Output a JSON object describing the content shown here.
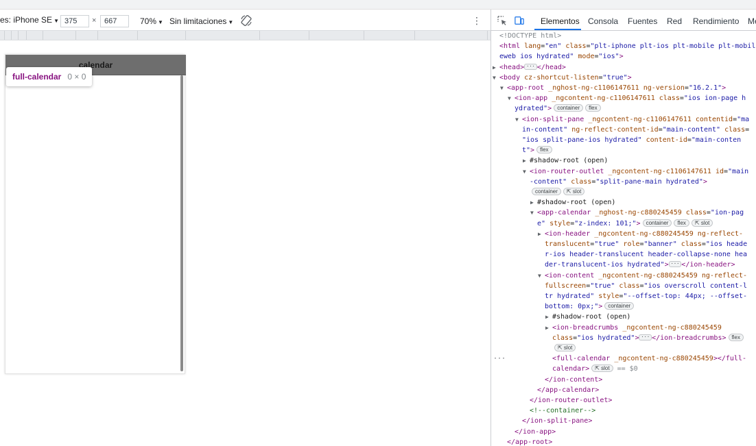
{
  "emulation": {
    "device_label": "es: iPhone SE",
    "width_value": "375",
    "times_sign": "×",
    "height_value": "667",
    "zoom_label": "70%",
    "throttle_label": "Sin limitaciones",
    "more_label": "⋮",
    "caret": "▼"
  },
  "phone": {
    "title": "calendar"
  },
  "inspect_tooltip": {
    "tag": "full-calendar",
    "size": "0 × 0"
  },
  "devtools": {
    "tabs": [
      "Elementos",
      "Consola",
      "Fuentes",
      "Red",
      "Rendimiento",
      "Me"
    ],
    "active_tab": "Elementos",
    "dom_lines": [
      {
        "indent": 0,
        "tri": "",
        "html": "<span class=\"g\">&lt;!DOCTYPE html&gt;</span>"
      },
      {
        "indent": 0,
        "tri": "",
        "html": "<span class=\"t\">&lt;html</span> <span class=\"a\">lang</span>=<span class=\"v\">\"en\"</span> <span class=\"a\">class</span>=<span class=\"v\">\"plt-iphone plt-ios plt-mobile plt-mobil</span>"
      },
      {
        "indent": 0,
        "tri": "",
        "html": "<span class=\"v\">eweb ios hydrated\"</span> <span class=\"a\">mode</span>=<span class=\"v\">\"ios\"</span><span class=\"t\">&gt;</span>"
      },
      {
        "indent": 0,
        "tri": "▶",
        "html": "<span class=\"t\">&lt;head&gt;</span><span class=\"ell\">···</span><span class=\"t\">&lt;/head&gt;</span>"
      },
      {
        "indent": 0,
        "tri": "▼",
        "html": "<span class=\"t\">&lt;body</span> <span class=\"a\">cz-shortcut-listen</span>=<span class=\"v\">\"true\"</span><span class=\"t\">&gt;</span>"
      },
      {
        "indent": 1,
        "tri": "▼",
        "html": "<span class=\"t\">&lt;app-root</span> <span class=\"a\">_nghost-ng-c1106147611</span> <span class=\"a\">ng-version</span>=<span class=\"v\">\"16.2.1\"</span><span class=\"t\">&gt;</span>"
      },
      {
        "indent": 2,
        "tri": "▼",
        "html": "<span class=\"t\">&lt;ion-app</span> <span class=\"a\">_ngcontent-ng-c1106147611</span> <span class=\"a\">class</span>=<span class=\"v\">\"ios ion-page h</span>"
      },
      {
        "indent": 2,
        "tri": "",
        "html": "<span class=\"v\">ydrated\"</span><span class=\"t\">&gt;</span><span class=\"badge\">container</span><span class=\"badge\">flex</span>"
      },
      {
        "indent": 3,
        "tri": "▼",
        "html": "<span class=\"t\">&lt;ion-split-pane</span> <span class=\"a\">_ngcontent-ng-c1106147611</span> <span class=\"a\">contentid</span>=<span class=\"v\">\"ma</span>"
      },
      {
        "indent": 3,
        "tri": "",
        "html": "<span class=\"v\">in-content\"</span> <span class=\"a\">ng-reflect-content-id</span>=<span class=\"v\">\"main-content\"</span> <span class=\"a\">class</span>="
      },
      {
        "indent": 3,
        "tri": "",
        "html": "<span class=\"v\">\"ios split-pane-ios hydrated\"</span> <span class=\"a\">content-id</span>=<span class=\"v\">\"main-conten</span>"
      },
      {
        "indent": 3,
        "tri": "",
        "html": "<span class=\"v\">t\"</span><span class=\"t\">&gt;</span><span class=\"badge\">flex</span>"
      },
      {
        "indent": 4,
        "tri": "▶",
        "html": "#shadow-root (open)"
      },
      {
        "indent": 4,
        "tri": "▼",
        "html": "<span class=\"t\">&lt;ion-router-outlet</span> <span class=\"a\">_ngcontent-ng-c1106147611</span> <span class=\"a\">id</span>=<span class=\"v\">\"main</span>"
      },
      {
        "indent": 4,
        "tri": "",
        "html": "<span class=\"v\">-content\"</span> <span class=\"a\">class</span>=<span class=\"v\">\"split-pane-main hydrated\"</span><span class=\"t\">&gt;</span>"
      },
      {
        "indent": 4,
        "tri": "",
        "html": "<span class=\"badge\">container</span><span class=\"badge\">⇱ slot</span>"
      },
      {
        "indent": 5,
        "tri": "▶",
        "html": "#shadow-root (open)"
      },
      {
        "indent": 5,
        "tri": "▼",
        "html": "<span class=\"t\">&lt;app-calendar</span> <span class=\"a\">_nghost-ng-c880245459</span> <span class=\"a\">class</span>=<span class=\"v\">\"ion-pag</span>"
      },
      {
        "indent": 5,
        "tri": "",
        "html": "<span class=\"v\">e\"</span> <span class=\"a\">style</span>=<span class=\"v\">\"z-index: 101;\"</span><span class=\"t\">&gt;</span><span class=\"badge\">container</span><span class=\"badge\">flex</span><span class=\"badge\">⇱ slot</span>"
      },
      {
        "indent": 6,
        "tri": "▶",
        "html": "<span class=\"t\">&lt;ion-header</span> <span class=\"a\">_ngcontent-ng-c880245459</span> <span class=\"a\">ng-reflect-</span>"
      },
      {
        "indent": 6,
        "tri": "",
        "html": "<span class=\"a\">translucent</span>=<span class=\"v\">\"true\"</span> <span class=\"a\">role</span>=<span class=\"v\">\"banner\"</span> <span class=\"a\">class</span>=<span class=\"v\">\"ios heade</span>"
      },
      {
        "indent": 6,
        "tri": "",
        "html": "<span class=\"v\">r-ios header-translucent header-collapse-none hea</span>"
      },
      {
        "indent": 6,
        "tri": "",
        "html": "<span class=\"v\">der-translucent-ios hydrated\"</span><span class=\"t\">&gt;</span><span class=\"ell\">···</span><span class=\"t\">&lt;/ion-header&gt;</span>"
      },
      {
        "indent": 6,
        "tri": "▼",
        "html": "<span class=\"t\">&lt;ion-content</span> <span class=\"a\">_ngcontent-ng-c880245459</span> <span class=\"a\">ng-reflect-</span>"
      },
      {
        "indent": 6,
        "tri": "",
        "html": "<span class=\"a\">fullscreen</span>=<span class=\"v\">\"true\"</span> <span class=\"a\">class</span>=<span class=\"v\">\"ios overscroll content-l</span>"
      },
      {
        "indent": 6,
        "tri": "",
        "html": "<span class=\"v\">tr hydrated\"</span> <span class=\"a\">style</span>=<span class=\"v\">\"--offset-top: 44px; --offset-</span>"
      },
      {
        "indent": 6,
        "tri": "",
        "html": "<span class=\"v\">bottom: 0px;\"</span><span class=\"t\">&gt;</span><span class=\"badge\">container</span>"
      },
      {
        "indent": 7,
        "tri": "▶",
        "html": "#shadow-root (open)"
      },
      {
        "indent": 7,
        "tri": "▶",
        "html": "<span class=\"t\">&lt;ion-breadcrumbs</span> <span class=\"a\">_ngcontent-ng-c880245459</span>"
      },
      {
        "indent": 7,
        "tri": "",
        "html": "<span class=\"a\">class</span>=<span class=\"v\">\"ios hydrated\"</span><span class=\"t\">&gt;</span><span class=\"ell\">···</span><span class=\"t\">&lt;/ion-breadcrumbs&gt;</span><span class=\"badge\">flex</span>"
      },
      {
        "indent": 7,
        "tri": "",
        "html": "<span class=\"badge\">⇱ slot</span>"
      },
      {
        "indent": 7,
        "tri": "",
        "sel": true,
        "dots": "···",
        "html": "<span class=\"t\">&lt;full-calendar</span> <span class=\"a\">_ngcontent-ng-c880245459</span><span class=\"t\">&gt;&lt;/full-</span>"
      },
      {
        "indent": 7,
        "tri": "",
        "sel": true,
        "html": "<span class=\"t\">calendar&gt;</span><span class=\"badge\">⇱ slot</span> <span class=\"g\">== $0</span>"
      },
      {
        "indent": 6,
        "tri": "",
        "html": "<span class=\"t\">&lt;/ion-content&gt;</span>"
      },
      {
        "indent": 5,
        "tri": "",
        "html": "<span class=\"t\">&lt;/app-calendar&gt;</span>"
      },
      {
        "indent": 4,
        "tri": "",
        "html": "<span class=\"t\">&lt;/ion-router-outlet&gt;</span>"
      },
      {
        "indent": 4,
        "tri": "",
        "html": "<span class=\"c\">&lt;!--container--&gt;</span>"
      },
      {
        "indent": 3,
        "tri": "",
        "html": "<span class=\"t\">&lt;/ion-split-pane&gt;</span>"
      },
      {
        "indent": 2,
        "tri": "",
        "html": "<span class=\"t\">&lt;/ion-app&gt;</span>"
      },
      {
        "indent": 1,
        "tri": "",
        "html": "<span class=\"t\">&lt;/app-root&gt;</span>"
      }
    ]
  },
  "colors": {
    "tag": "#881280",
    "attr": "#994500",
    "value": "#1a1aa6",
    "comment": "#236e25",
    "selection": "#cfe8fc",
    "active_tab": "#1a73e8",
    "phone_header": "#6e6e6e"
  },
  "icons": [
    "inspect-element-icon",
    "device-toolbar-icon",
    "rotate-icon",
    "more-options-icon"
  ]
}
